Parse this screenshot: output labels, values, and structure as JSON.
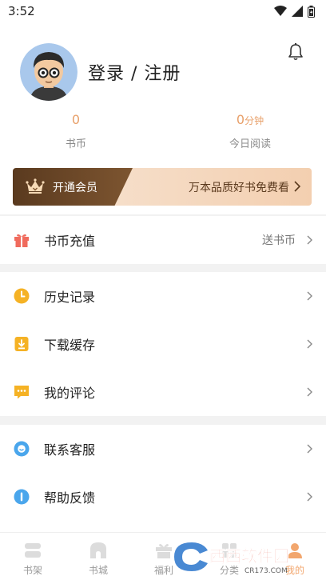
{
  "status_bar": {
    "time": "3:52"
  },
  "profile": {
    "title": "登录 / 注册",
    "stats": [
      {
        "value": "0",
        "unit": "",
        "label": "书币"
      },
      {
        "value": "0",
        "unit": "分钟",
        "label": "今日阅读"
      }
    ]
  },
  "vip": {
    "title": "开通会员",
    "slogan": "万本品质好书免费看"
  },
  "menu": {
    "recharge": {
      "label": "书币充值",
      "extra": "送书币"
    },
    "history": {
      "label": "历史记录"
    },
    "download": {
      "label": "下载缓存"
    },
    "comments": {
      "label": "我的评论"
    },
    "service": {
      "label": "联系客服"
    },
    "feedback": {
      "label": "帮助反馈"
    }
  },
  "tabbar": {
    "tabs": [
      {
        "label": "书架"
      },
      {
        "label": "书城"
      },
      {
        "label": "福利"
      },
      {
        "label": "分类"
      },
      {
        "label": "我的"
      }
    ]
  },
  "watermark": {
    "text": "西西软件园",
    "sub": "CR173.COM"
  },
  "colors": {
    "accent": "#e8a06a",
    "vip_dark": "#5a3a1f",
    "vip_light": "#f3cfb0"
  }
}
